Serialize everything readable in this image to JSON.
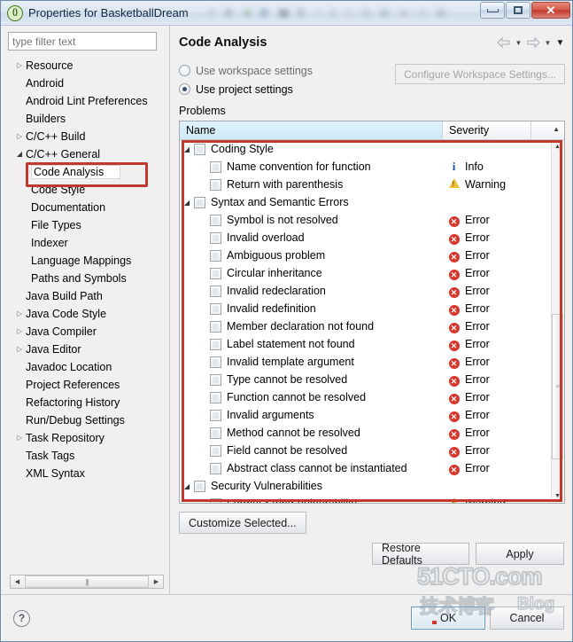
{
  "window": {
    "title": "Properties for BasketballDream",
    "app_icon": "braces-icon",
    "controls": {
      "minimize": "minimize-icon",
      "maximize": "maximize-icon",
      "close": "✕"
    }
  },
  "sidebar": {
    "filter_placeholder": "type filter text",
    "filter_value": "",
    "items": [
      {
        "label": "Resource",
        "level": 0,
        "expandable": true,
        "expanded": false
      },
      {
        "label": "Android",
        "level": 0,
        "expandable": false,
        "expanded": false
      },
      {
        "label": "Android Lint Preferences",
        "level": 0,
        "expandable": false,
        "expanded": false
      },
      {
        "label": "Builders",
        "level": 0,
        "expandable": false,
        "expanded": false
      },
      {
        "label": "C/C++ Build",
        "level": 0,
        "expandable": true,
        "expanded": false
      },
      {
        "label": "C/C++ General",
        "level": 0,
        "expandable": true,
        "expanded": true
      },
      {
        "label": "Code Analysis",
        "level": 1,
        "expandable": true,
        "expanded": false,
        "selected": true
      },
      {
        "label": "Code Style",
        "level": 1,
        "expandable": false,
        "expanded": false
      },
      {
        "label": "Documentation",
        "level": 1,
        "expandable": false,
        "expanded": false
      },
      {
        "label": "File Types",
        "level": 1,
        "expandable": false,
        "expanded": false
      },
      {
        "label": "Indexer",
        "level": 1,
        "expandable": false,
        "expanded": false
      },
      {
        "label": "Language Mappings",
        "level": 1,
        "expandable": false,
        "expanded": false
      },
      {
        "label": "Paths and Symbols",
        "level": 1,
        "expandable": false,
        "expanded": false
      },
      {
        "label": "Java Build Path",
        "level": 0,
        "expandable": false,
        "expanded": false
      },
      {
        "label": "Java Code Style",
        "level": 0,
        "expandable": true,
        "expanded": false
      },
      {
        "label": "Java Compiler",
        "level": 0,
        "expandable": true,
        "expanded": false
      },
      {
        "label": "Java Editor",
        "level": 0,
        "expandable": true,
        "expanded": false
      },
      {
        "label": "Javadoc Location",
        "level": 0,
        "expandable": false,
        "expanded": false
      },
      {
        "label": "Project References",
        "level": 0,
        "expandable": false,
        "expanded": false
      },
      {
        "label": "Refactoring History",
        "level": 0,
        "expandable": false,
        "expanded": false
      },
      {
        "label": "Run/Debug Settings",
        "level": 0,
        "expandable": false,
        "expanded": false
      },
      {
        "label": "Task Repository",
        "level": 0,
        "expandable": true,
        "expanded": false
      },
      {
        "label": "Task Tags",
        "level": 0,
        "expandable": false,
        "expanded": false
      },
      {
        "label": "XML Syntax",
        "level": 0,
        "expandable": false,
        "expanded": false
      }
    ]
  },
  "page": {
    "title": "Code Analysis",
    "nav": {
      "back": "back-arrow-icon",
      "back_menu": "chevron-down-icon",
      "forward": "forward-arrow-icon",
      "forward_menu": "chevron-down-icon",
      "view_menu": "chevron-down-icon"
    },
    "settings_scope": {
      "workspace_label": "Use workspace settings",
      "project_label": "Use project settings",
      "selected": "project",
      "configure_button": "Configure Workspace Settings...",
      "configure_enabled": false
    },
    "problems_label": "Problems",
    "table": {
      "columns": [
        "Name",
        "Severity"
      ],
      "sort_indicator": "▲",
      "rows": [
        {
          "name": "Coding Style",
          "severity": "",
          "level": 0,
          "expanded": true,
          "checked": false
        },
        {
          "name": "Name convention for function",
          "severity": "Info",
          "icon": "info-icon",
          "level": 1,
          "checked": false
        },
        {
          "name": "Return with parenthesis",
          "severity": "Warning",
          "icon": "warning-icon",
          "level": 1,
          "checked": false
        },
        {
          "name": "Syntax and Semantic Errors",
          "severity": "",
          "level": 0,
          "expanded": true,
          "checked": false
        },
        {
          "name": "Symbol is not resolved",
          "severity": "Error",
          "icon": "error-icon",
          "level": 1,
          "checked": false
        },
        {
          "name": "Invalid overload",
          "severity": "Error",
          "icon": "error-icon",
          "level": 1,
          "checked": false
        },
        {
          "name": "Ambiguous problem",
          "severity": "Error",
          "icon": "error-icon",
          "level": 1,
          "checked": false
        },
        {
          "name": "Circular inheritance",
          "severity": "Error",
          "icon": "error-icon",
          "level": 1,
          "checked": false
        },
        {
          "name": "Invalid redeclaration",
          "severity": "Error",
          "icon": "error-icon",
          "level": 1,
          "checked": false
        },
        {
          "name": "Invalid redefinition",
          "severity": "Error",
          "icon": "error-icon",
          "level": 1,
          "checked": false
        },
        {
          "name": "Member declaration not found",
          "severity": "Error",
          "icon": "error-icon",
          "level": 1,
          "checked": false
        },
        {
          "name": "Label statement not found",
          "severity": "Error",
          "icon": "error-icon",
          "level": 1,
          "checked": false
        },
        {
          "name": "Invalid template argument",
          "severity": "Error",
          "icon": "error-icon",
          "level": 1,
          "checked": false
        },
        {
          "name": "Type cannot be resolved",
          "severity": "Error",
          "icon": "error-icon",
          "level": 1,
          "checked": false
        },
        {
          "name": "Function cannot be resolved",
          "severity": "Error",
          "icon": "error-icon",
          "level": 1,
          "checked": false
        },
        {
          "name": "Invalid arguments",
          "severity": "Error",
          "icon": "error-icon",
          "level": 1,
          "checked": false
        },
        {
          "name": "Method cannot be resolved",
          "severity": "Error",
          "icon": "error-icon",
          "level": 1,
          "checked": false
        },
        {
          "name": "Field cannot be resolved",
          "severity": "Error",
          "icon": "error-icon",
          "level": 1,
          "checked": false
        },
        {
          "name": "Abstract class cannot be instantiated",
          "severity": "Error",
          "icon": "error-icon",
          "level": 1,
          "checked": false
        },
        {
          "name": "Security Vulnerabilities",
          "severity": "",
          "level": 0,
          "expanded": true,
          "checked": false
        },
        {
          "name": "Format String Vulnerability",
          "severity": "Warning",
          "icon": "warning-icon",
          "level": 1,
          "checked": false
        }
      ]
    },
    "buttons": {
      "customize_selected": "Customize Selected...",
      "restore_defaults": "Restore Defaults",
      "apply": "Apply"
    }
  },
  "footer": {
    "help": "help-icon",
    "ok": "OK",
    "cancel": "Cancel"
  },
  "watermark": {
    "line1": "51CTO.com",
    "line2": "技术博客",
    "line3": "Blog"
  },
  "colors": {
    "accent_red": "#c0392b",
    "error": "#d9342b",
    "warning": "#f0c23a",
    "info": "#1c4f9c",
    "header_blue": "#cfe9f7"
  }
}
